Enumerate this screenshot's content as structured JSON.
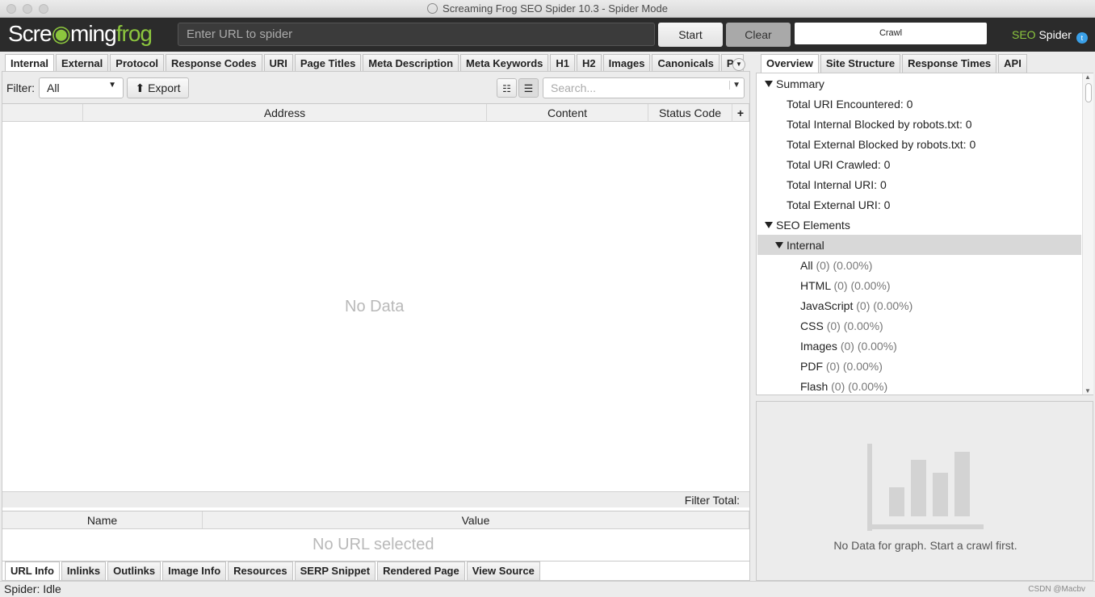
{
  "window": {
    "title": "Screaming Frog SEO Spider 10.3 - Spider Mode"
  },
  "toolbar": {
    "logo_part1": "Scre",
    "logo_part2": "ming",
    "logo_part3": "frog",
    "url_placeholder": "Enter URL to spider",
    "start_label": "Start",
    "clear_label": "Clear",
    "crawl_label": "Crawl",
    "brand_seo": "SEO",
    "brand_spider": "Spider"
  },
  "left_tabs": [
    "Internal",
    "External",
    "Protocol",
    "Response Codes",
    "URI",
    "Page Titles",
    "Meta Description",
    "Meta Keywords",
    "H1",
    "H2",
    "Images",
    "Canonicals",
    "Pag"
  ],
  "filter": {
    "label": "Filter:",
    "value": "All",
    "export_label": "Export",
    "search_placeholder": "Search..."
  },
  "main_table": {
    "columns": [
      "Address",
      "Content",
      "Status Code"
    ],
    "empty_text": "No Data",
    "filter_total_label": "Filter Total:"
  },
  "detail_table": {
    "columns": [
      "Name",
      "Value"
    ],
    "empty_text": "No URL selected"
  },
  "bottom_tabs": [
    "URL Info",
    "Inlinks",
    "Outlinks",
    "Image Info",
    "Resources",
    "SERP Snippet",
    "Rendered Page",
    "View Source"
  ],
  "status": "Spider: Idle",
  "right_tabs": [
    "Overview",
    "Site Structure",
    "Response Times",
    "API"
  ],
  "overview": {
    "summary_label": "Summary",
    "summary_items": [
      "Total URI Encountered: 0",
      "Total Internal Blocked by robots.txt: 0",
      "Total External Blocked by robots.txt: 0",
      "Total URI Crawled: 0",
      "Total Internal URI: 0",
      "Total External URI: 0"
    ],
    "seo_elements_label": "SEO Elements",
    "internal_label": "Internal",
    "internal_items": [
      {
        "name": "All",
        "stats": "(0) (0.00%)"
      },
      {
        "name": "HTML",
        "stats": "(0) (0.00%)"
      },
      {
        "name": "JavaScript",
        "stats": "(0) (0.00%)"
      },
      {
        "name": "CSS",
        "stats": "(0) (0.00%)"
      },
      {
        "name": "Images",
        "stats": "(0) (0.00%)"
      },
      {
        "name": "PDF",
        "stats": "(0) (0.00%)"
      },
      {
        "name": "Flash",
        "stats": "(0) (0.00%)"
      }
    ]
  },
  "graph": {
    "empty_text": "No Data for graph. Start a crawl first."
  },
  "watermark": "CSDN @Macbv"
}
